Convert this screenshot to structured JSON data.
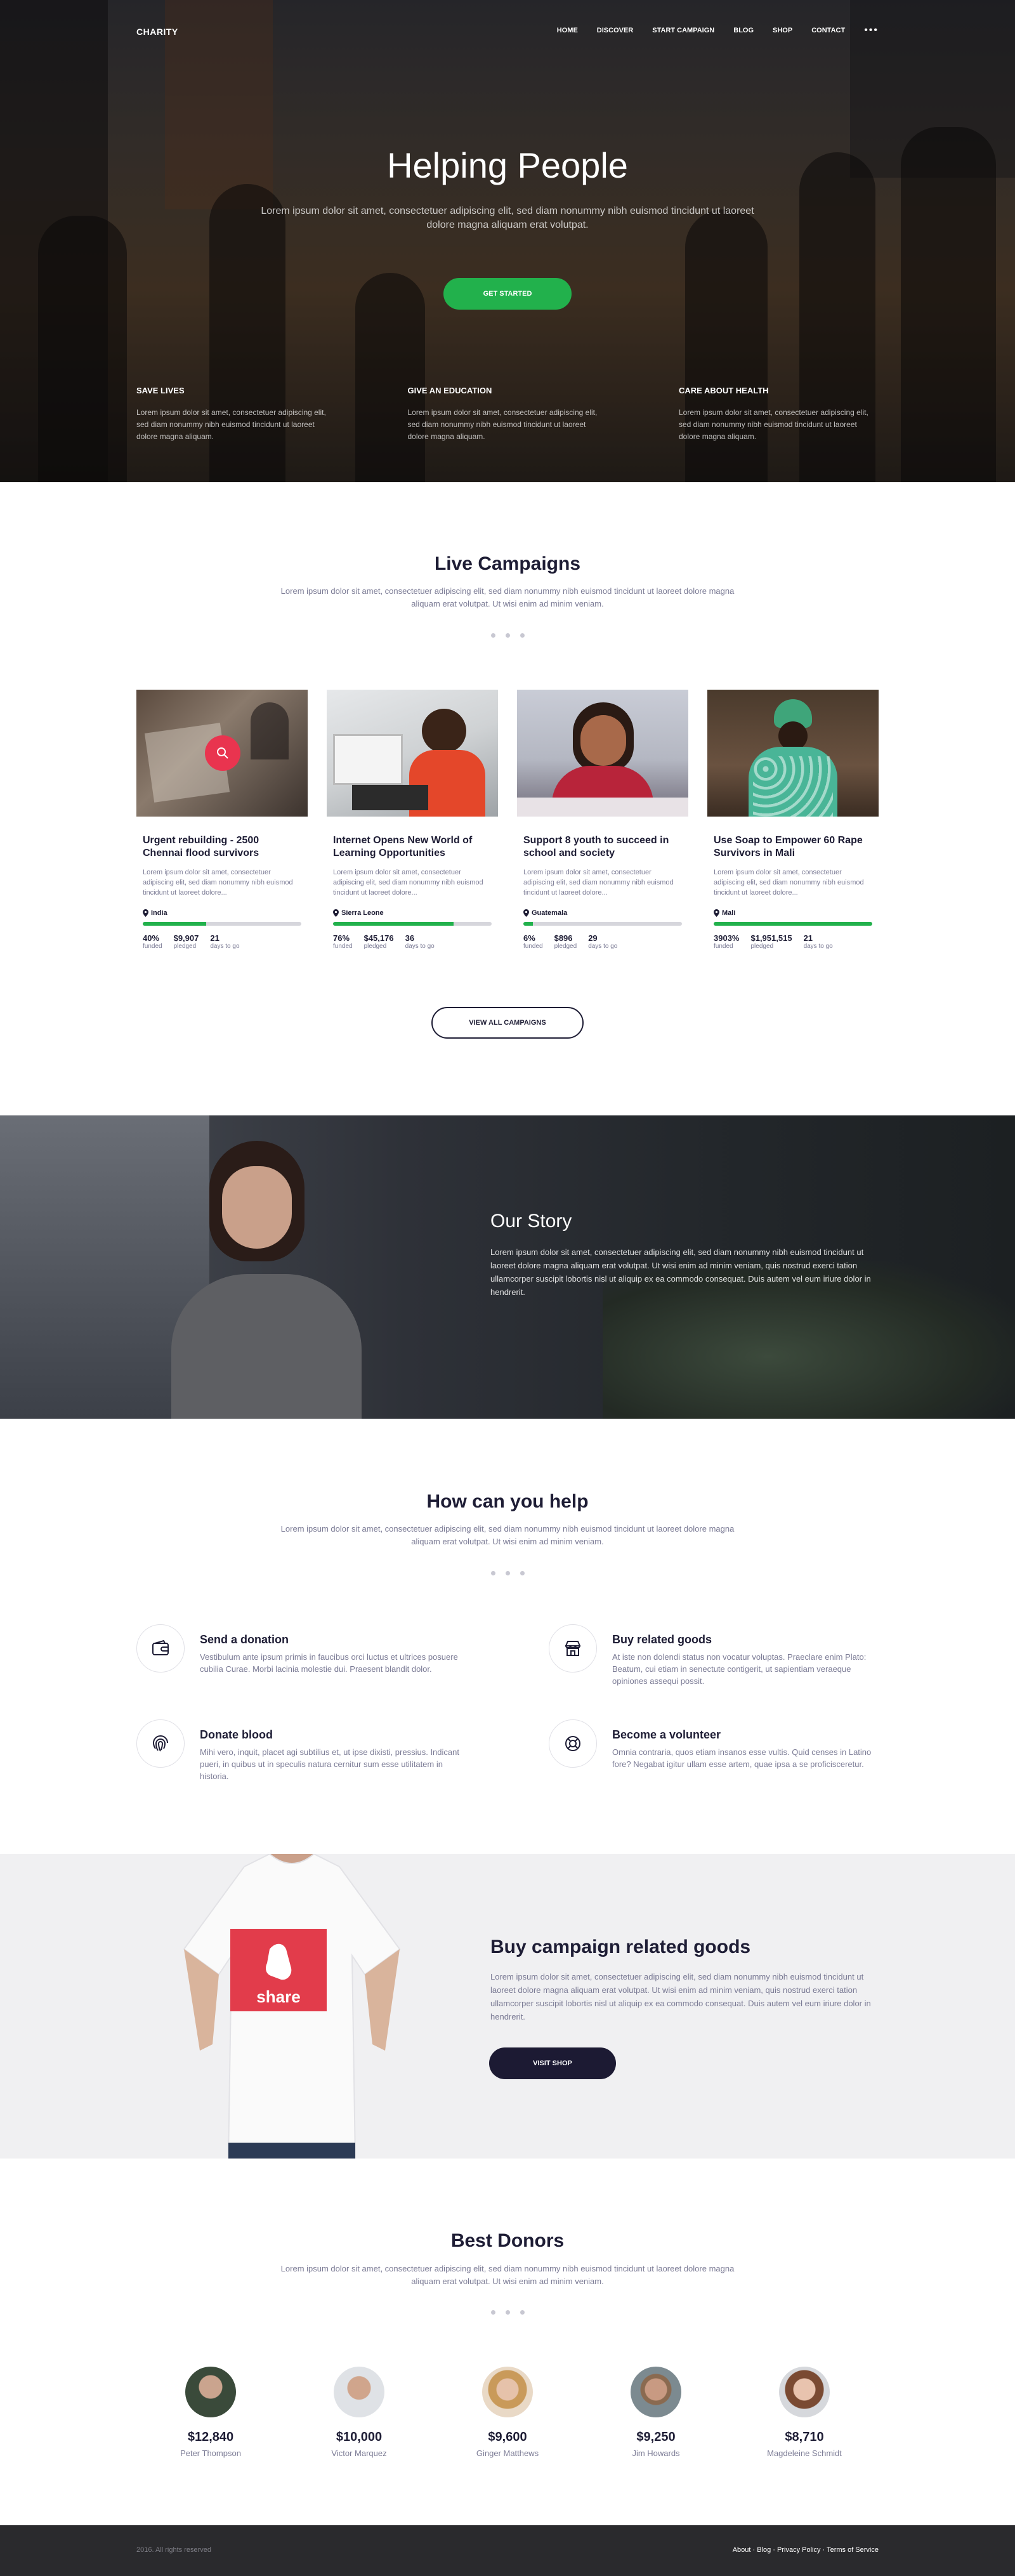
{
  "nav": {
    "logo": "CHARITY",
    "items": [
      "HOME",
      "DISCOVER",
      "START CAMPAIGN",
      "BLOG",
      "SHOP",
      "CONTACT"
    ],
    "more_icon": "ellipsis-icon"
  },
  "hero": {
    "title": "Helping People",
    "subtitle": "Lorem ipsum dolor sit amet, consectetuer adipiscing elit, sed diam nonummy nibh euismod tincidunt ut laoreet dolore magna aliquam erat volutpat.",
    "button": "GET STARTED",
    "features": [
      {
        "title": "SAVE LIVES",
        "text": "Lorem ipsum dolor sit amet, consectetuer adipiscing elit, sed diam nonummy nibh euismod tincidunt ut laoreet dolore magna aliquam."
      },
      {
        "title": "GIVE AN EDUCATION",
        "text": "Lorem ipsum dolor sit amet, consectetuer adipiscing elit, sed diam nonummy nibh euismod tincidunt ut laoreet dolore magna aliquam."
      },
      {
        "title": "CARE ABOUT HEALTH",
        "text": "Lorem ipsum dolor sit amet, consectetuer adipiscing elit, sed diam nonummy nibh euismod tincidunt ut laoreet dolore magna aliquam."
      }
    ]
  },
  "campaigns": {
    "title": "Live Campaigns",
    "subtitle": "Lorem ipsum dolor sit amet, consectetuer adipiscing elit, sed diam nonummy nibh euismod tincidunt ut laoreet dolore magna aliquam erat volutpat. Ut wisi enim ad minim veniam.",
    "cards": [
      {
        "title": "Urgent rebuilding - 2500 Chennai flood survivors",
        "text": "Lorem ipsum dolor sit amet, consectetuer adipiscing elit, sed diam nonummy nibh euismod tincidunt ut laoreet dolore...",
        "location": "India",
        "funded": "40%",
        "pledged": "$9,907",
        "days": "21",
        "progress": 0.4,
        "funded_label": "funded",
        "pledged_label": "pledged",
        "days_label": "days to go"
      },
      {
        "title": "Internet Opens New World of Learning Opportunities",
        "text": "Lorem ipsum dolor sit amet, consectetuer adipiscing elit, sed diam nonummy nibh euismod tincidunt ut laoreet dolore...",
        "location": "Sierra Leone",
        "funded": "76%",
        "pledged": "$45,176",
        "days": "36",
        "progress": 0.76,
        "funded_label": "funded",
        "pledged_label": "pledged",
        "days_label": "days to go"
      },
      {
        "title": "Support 8 youth to succeed in school and society",
        "text": "Lorem ipsum dolor sit amet, consectetuer adipiscing elit, sed diam nonummy nibh euismod tincidunt ut laoreet dolore...",
        "location": "Guatemala",
        "funded": "6%",
        "pledged": "$896",
        "days": "29",
        "progress": 0.06,
        "funded_label": "funded",
        "pledged_label": "pledged",
        "days_label": "days to go"
      },
      {
        "title": "Use Soap to Empower 60 Rape Survivors in Mali",
        "text": "Lorem ipsum dolor sit amet, consectetuer adipiscing elit, sed diam nonummy nibh euismod tincidunt ut laoreet dolore...",
        "location": "Mali",
        "funded": "3903%",
        "pledged": "$1,951,515",
        "days": "21",
        "progress": 1.0,
        "funded_label": "funded",
        "pledged_label": "pledged",
        "days_label": "days to go"
      }
    ],
    "button": "VIEW ALL CAMPAIGNS"
  },
  "story": {
    "title": "Our Story",
    "text": "Lorem ipsum dolor sit amet, consectetuer adipiscing elit, sed diam nonummy nibh euismod tincidunt ut laoreet dolore magna aliquam erat volutpat. Ut wisi enim ad minim veniam, quis nostrud exerci tation ullamcorper suscipit lobortis nisl ut aliquip ex ea commodo consequat. Duis autem vel eum iriure dolor in hendrerit."
  },
  "help": {
    "title": "How can you help",
    "subtitle": "Lorem ipsum dolor sit amet, consectetuer adipiscing elit, sed diam nonummy nibh euismod tincidunt ut laoreet dolore magna aliquam erat volutpat. Ut wisi enim ad minim veniam.",
    "items": [
      {
        "icon": "wallet-icon",
        "title": "Send a donation",
        "text": "Vestibulum ante ipsum primis in faucibus orci luctus et ultrices posuere cubilia Curae. Morbi lacinia molestie dui. Praesent blandit dolor."
      },
      {
        "icon": "shop-icon",
        "title": "Buy related goods",
        "text": "At iste non dolendi status non vocatur voluptas. Praeclare enim Plato: Beatum, cui etiam in senectute contigerit, ut sapientiam veraeque opiniones assequi possit."
      },
      {
        "icon": "fingerprint-icon",
        "title": "Donate blood",
        "text": "Mihi vero, inquit, placet agi subtilius et, ut ipse dixisti, pressius. Indicant pueri, in quibus ut in speculis natura cernitur sum esse utilitatem in historia."
      },
      {
        "icon": "lifebuoy-icon",
        "title": "Become a volunteer",
        "text": "Omnia contraria, quos etiam insanos esse vultis. Quid censes in Latino fore? Negabat igitur ullam esse artem, quae ipsa a se proficisceretur."
      }
    ]
  },
  "goods": {
    "title": "Buy campaign related goods",
    "text": "Lorem ipsum dolor sit amet, consectetuer adipiscing elit, sed diam nonummy nibh euismod tincidunt ut laoreet dolore magna aliquam erat volutpat. Ut wisi enim ad minim veniam, quis nostrud exerci tation ullamcorper suscipit lobortis nisl ut aliquip ex ea commodo consequat. Duis autem vel eum iriure dolor in hendrerit.",
    "shirt_text": "share",
    "button": "VISIT SHOP"
  },
  "donors": {
    "title": "Best Donors",
    "subtitle": "Lorem ipsum dolor sit amet, consectetuer adipiscing elit, sed diam nonummy nibh euismod tincidunt ut laoreet dolore magna aliquam erat volutpat. Ut wisi enim ad minim veniam.",
    "list": [
      {
        "amount": "$12,840",
        "name": "Peter Thompson"
      },
      {
        "amount": "$10,000",
        "name": "Victor Marquez"
      },
      {
        "amount": "$9,600",
        "name": "Ginger Matthews"
      },
      {
        "amount": "$9,250",
        "name": "Jim Howards"
      },
      {
        "amount": "$8,710",
        "name": "Magdeleine Schmidt"
      }
    ]
  },
  "footer": {
    "copyright": "2016. All rights reserved",
    "links": [
      "About",
      "Blog",
      "Privacy Policy",
      "Terms of Service"
    ]
  },
  "colors": {
    "accent_green": "#22b14c",
    "accent_red": "#e9344f",
    "dark": "#1c1a33",
    "footer": "#2a2a2d"
  }
}
